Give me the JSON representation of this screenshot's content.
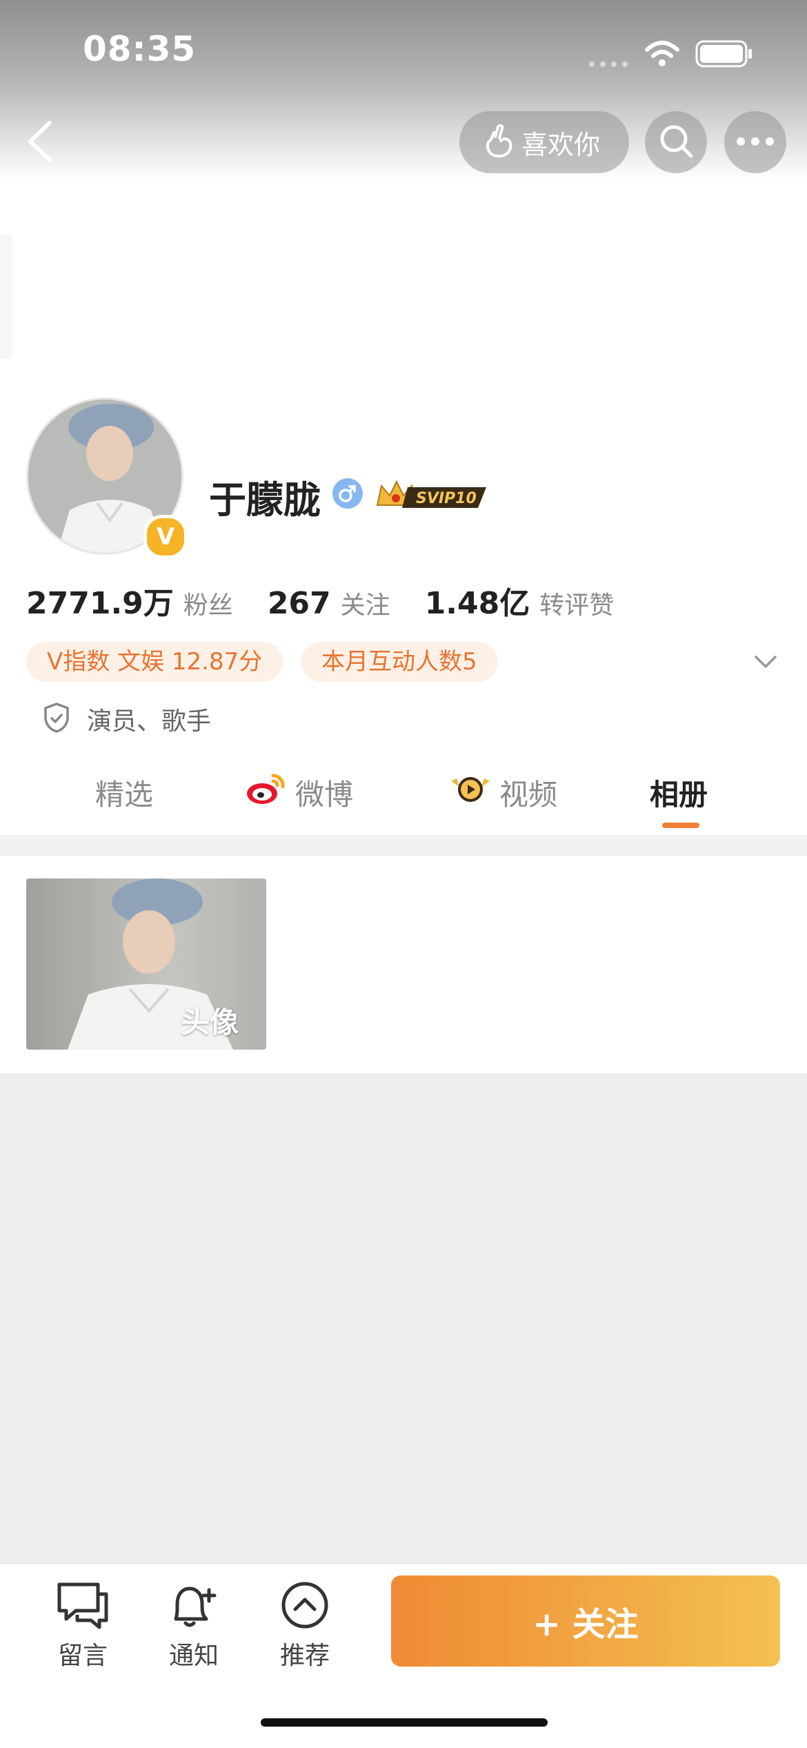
{
  "status_bar": {
    "time": "08:35"
  },
  "nav": {
    "like_label": "喜欢你"
  },
  "profile": {
    "name": "于朦胧",
    "vip_badge": "SVIP10",
    "verified_mark": "V",
    "stats": [
      {
        "value": "2771.9万",
        "label": "粉丝"
      },
      {
        "value": "267",
        "label": "关注"
      },
      {
        "value": "1.48亿",
        "label": "转评赞"
      }
    ],
    "tags": [
      "V指数 文娱 12.87分",
      "本月互动人数5"
    ],
    "occupation": "演员、歌手"
  },
  "tabs": [
    {
      "label": "精选",
      "icon": ""
    },
    {
      "label": "微博",
      "icon": "weibo-logo-icon"
    },
    {
      "label": "视频",
      "icon": "video-channel-icon"
    },
    {
      "label": "相册",
      "icon": "",
      "active": true
    }
  ],
  "album": {
    "items": [
      {
        "label": "头像"
      }
    ]
  },
  "bottom_bar": {
    "items": [
      {
        "label": "留言",
        "icon": "message-icon"
      },
      {
        "label": "通知",
        "icon": "bell-add-icon"
      },
      {
        "label": "推荐",
        "icon": "chevron-up-circle-icon"
      }
    ],
    "follow_label": "+ 关注"
  },
  "colors": {
    "accent": "#f07f35",
    "tag_bg": "#fdf1e7",
    "follow_start": "#ef8a34",
    "follow_end": "#f4c152"
  }
}
